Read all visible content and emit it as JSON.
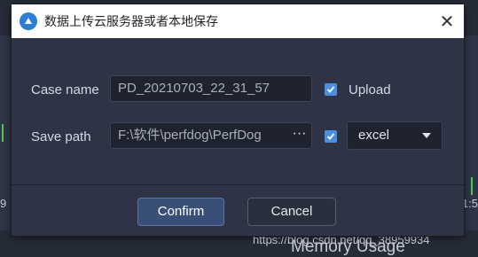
{
  "dialog": {
    "title": "数据上传云服务器或者本地保存",
    "close_symbol": "✕"
  },
  "form": {
    "case_name_label": "Case name",
    "case_name_value": "PD_20210703_22_31_57",
    "upload_label": "Upload",
    "upload_checked": true,
    "save_path_label": "Save path",
    "save_path_value": "F:\\软件\\perfdog\\PerfDog",
    "browse_label": "···",
    "export_checked": true,
    "format_selected": "excel"
  },
  "buttons": {
    "confirm": "Confirm",
    "cancel": "Cancel"
  },
  "background": {
    "tick_left": "9",
    "tick_right": "1:5",
    "panel_title": "Memory Usage",
    "watermark": "https://blog.csdn.net/qq_38959934"
  },
  "colors": {
    "dialog_bg": "#2e3446",
    "accent": "#4a8fe0",
    "confirm_bg": "#3a4f78",
    "input_bg": "#1f2330"
  },
  "icons": {
    "app": "perfdog-app-icon",
    "close": "close-icon",
    "checkbox": "checkmark-icon",
    "dropdown": "chevron-down-icon"
  }
}
